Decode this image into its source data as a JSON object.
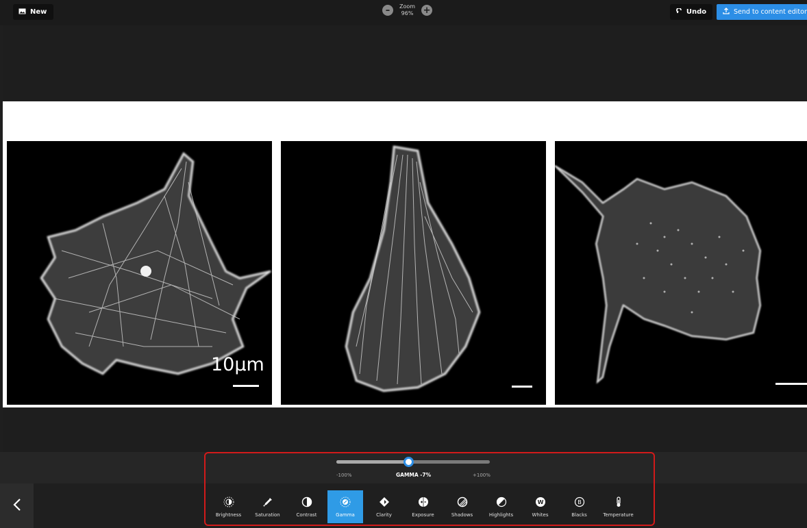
{
  "toolbar": {
    "new_label": "New",
    "zoom_label": "Zoom",
    "zoom_value": "96%",
    "undo_label": "Undo",
    "send_label": "Send to content editor"
  },
  "image": {
    "scale_bar_label": "10µm"
  },
  "adjust": {
    "min_label": "-100%",
    "current_label": "GAMMA -7%",
    "max_label": "+100%",
    "value_fraction": 0.47,
    "accent_color": "#2f9be6",
    "tools": [
      {
        "label": "Brightness",
        "icon": "brightness-icon"
      },
      {
        "label": "Saturation",
        "icon": "eyedropper-icon"
      },
      {
        "label": "Contrast",
        "icon": "contrast-icon"
      },
      {
        "label": "Gamma",
        "icon": "gamma-icon",
        "active": true
      },
      {
        "label": "Clarity",
        "icon": "clarity-icon"
      },
      {
        "label": "Exposure",
        "icon": "exposure-icon"
      },
      {
        "label": "Shadows",
        "icon": "shadows-icon"
      },
      {
        "label": "Highlights",
        "icon": "highlights-icon"
      },
      {
        "label": "Whites",
        "icon": "whites-icon"
      },
      {
        "label": "Blacks",
        "icon": "blacks-icon"
      },
      {
        "label": "Temperature",
        "icon": "thermometer-icon"
      }
    ]
  }
}
